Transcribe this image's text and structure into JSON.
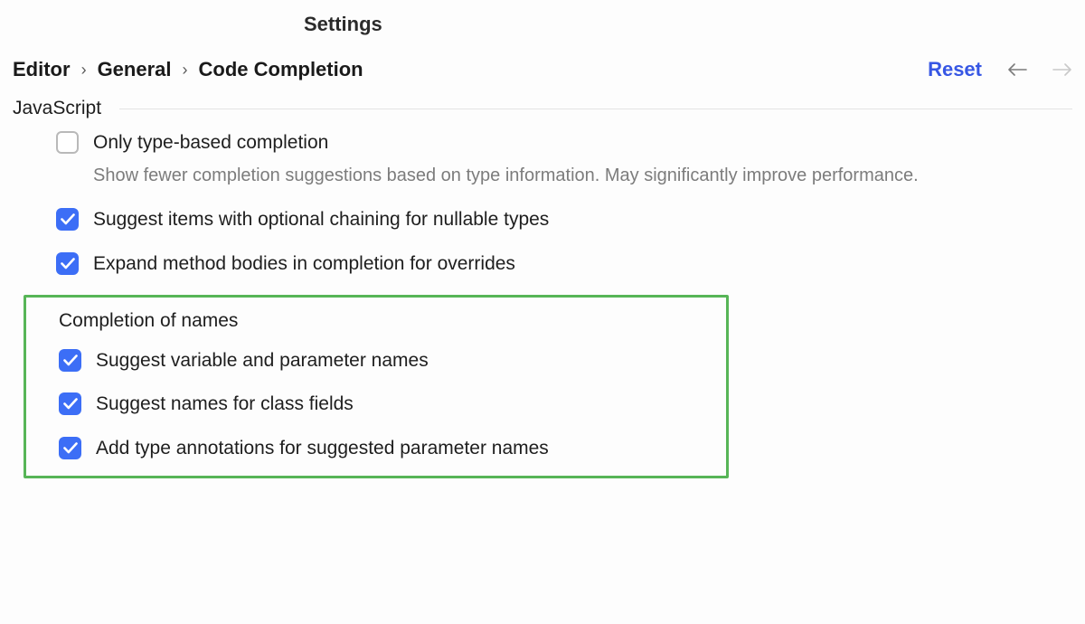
{
  "title": "Settings",
  "breadcrumb": {
    "a": "Editor",
    "b": "General",
    "c": "Code Completion"
  },
  "reset": "Reset",
  "section": "JavaScript",
  "opts": {
    "type_based": {
      "label": "Only type-based completion",
      "desc": "Show fewer completion suggestions based on type information. May significantly improve performance.",
      "checked": false
    },
    "optional_chaining": {
      "label": "Suggest items with optional chaining for nullable types",
      "checked": true
    },
    "expand_bodies": {
      "label": "Expand method bodies in completion for overrides",
      "checked": true
    }
  },
  "group": {
    "title": "Completion of names",
    "var_param": {
      "label": "Suggest variable and parameter names",
      "checked": true
    },
    "class_fields": {
      "label": "Suggest names for class fields",
      "checked": true
    },
    "type_annot": {
      "label": "Add type annotations for suggested parameter names",
      "checked": true
    }
  }
}
